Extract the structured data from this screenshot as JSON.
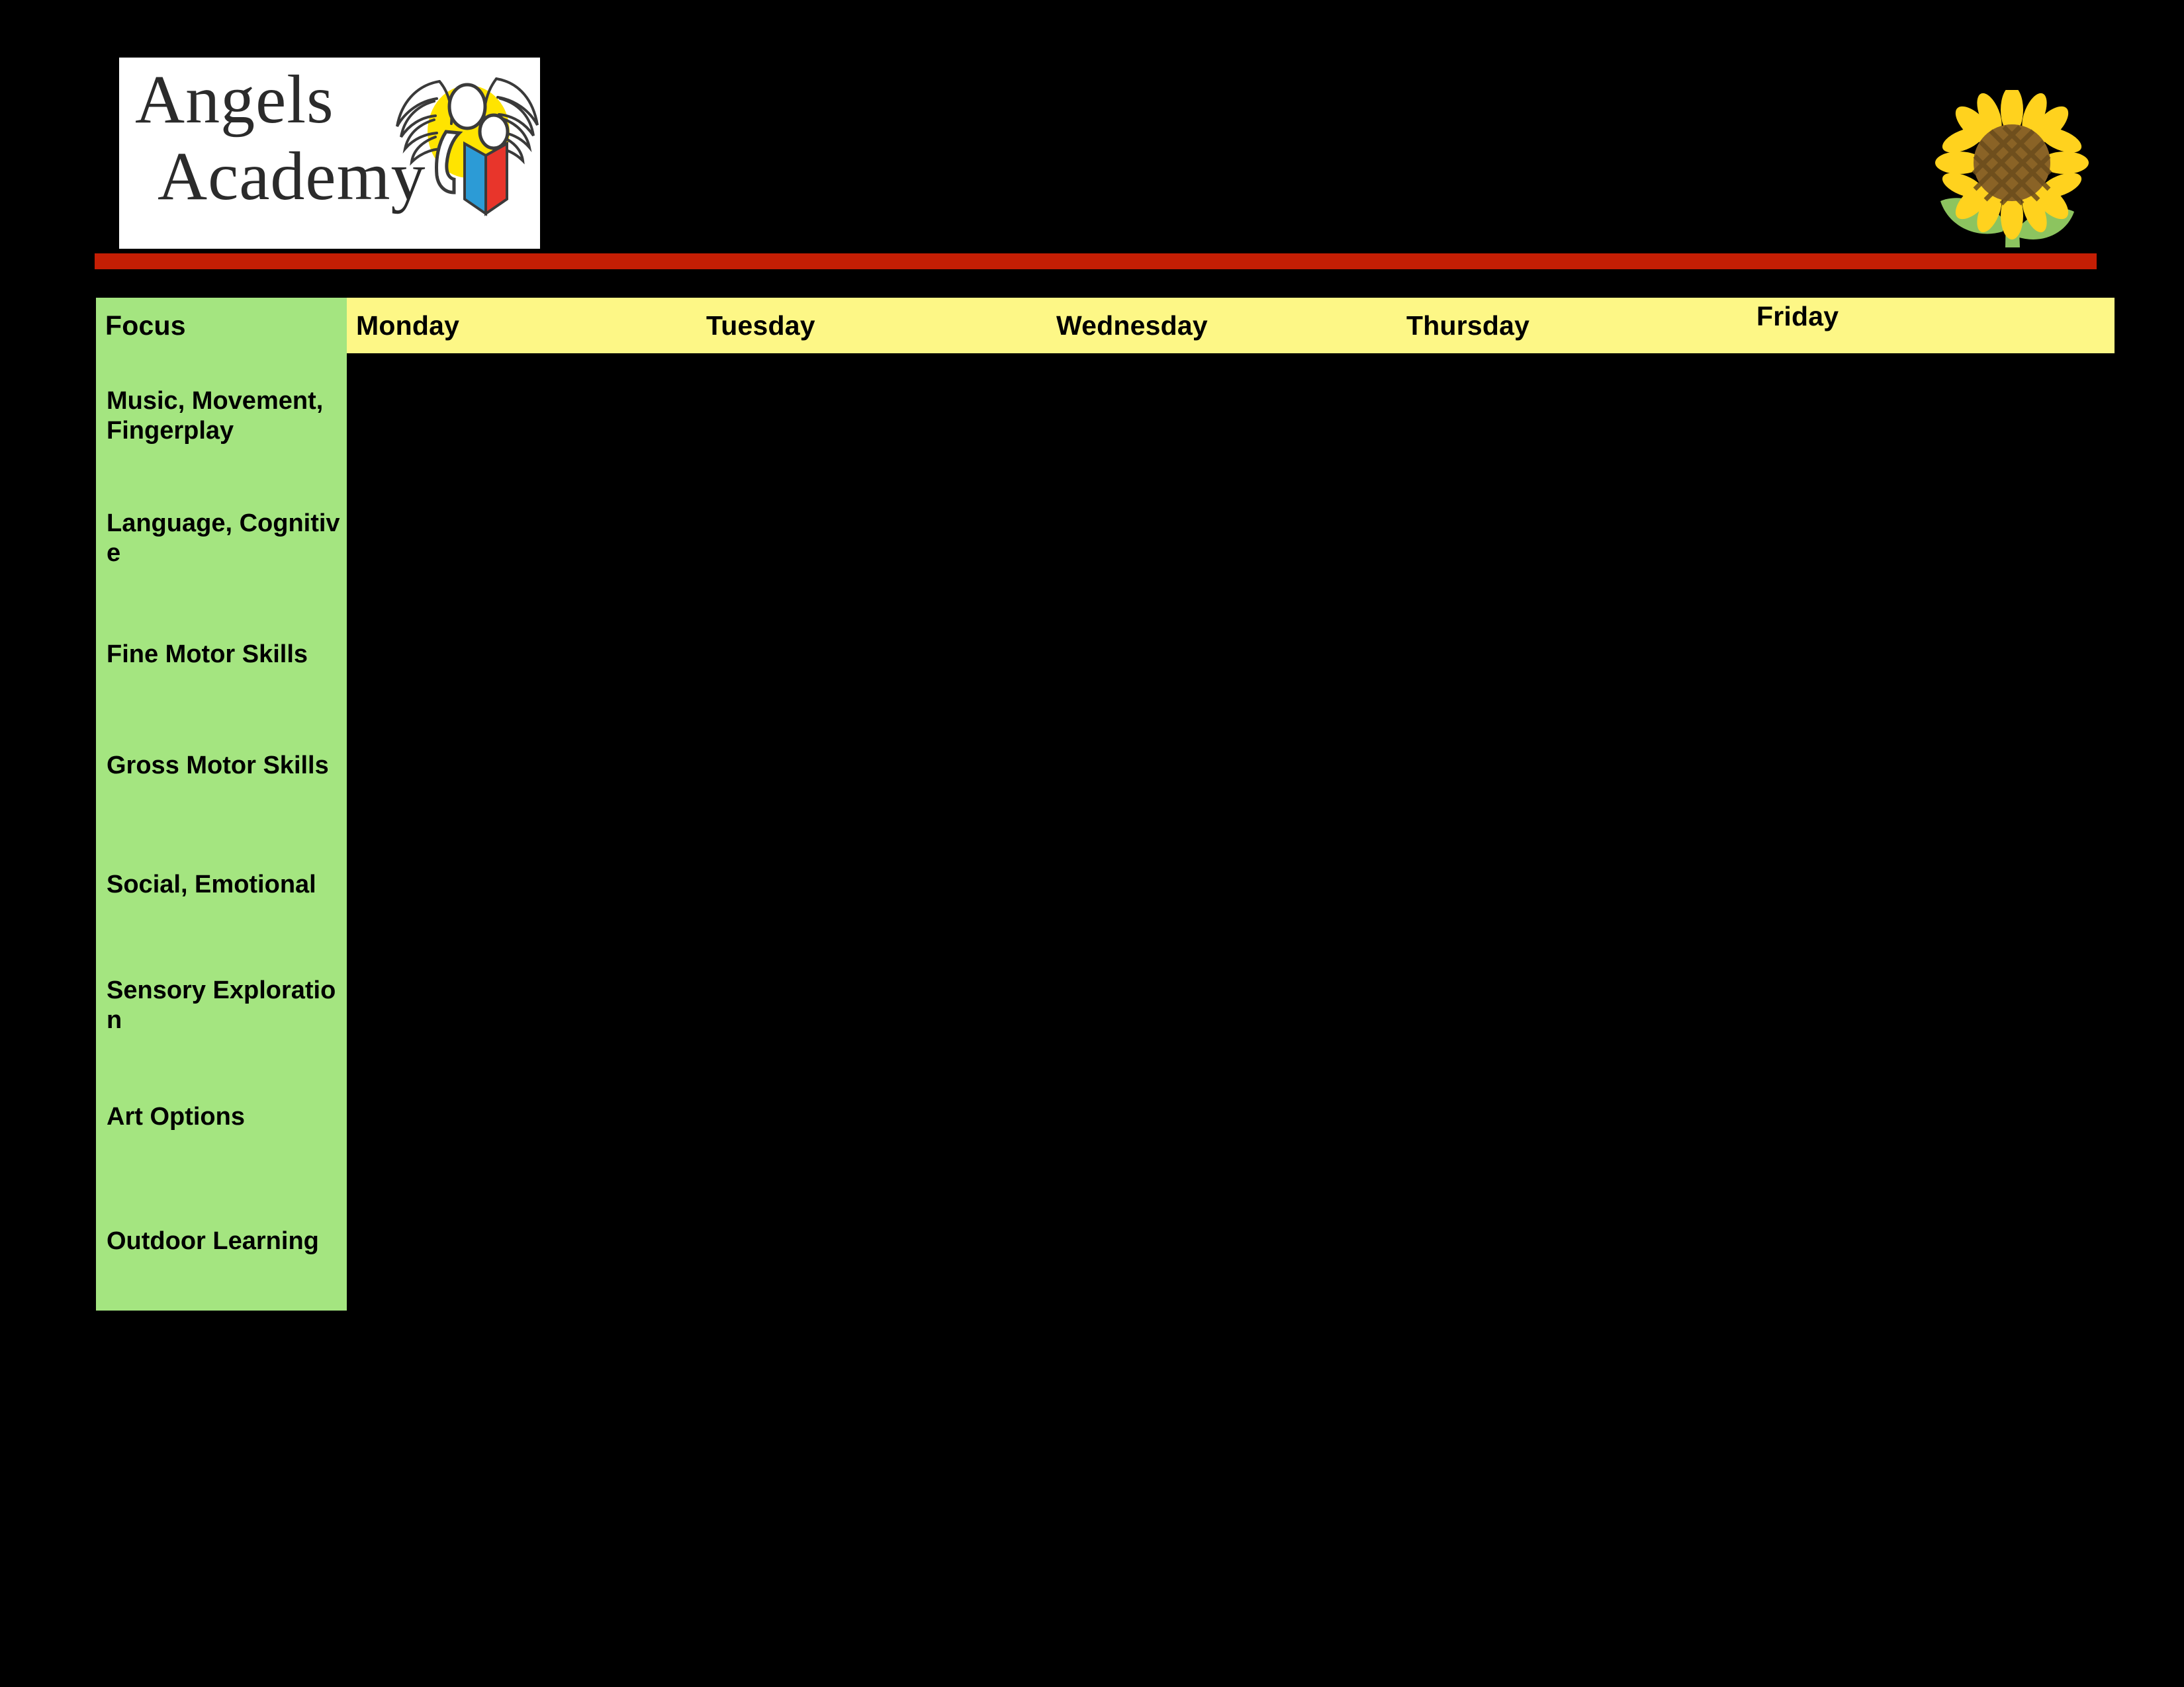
{
  "branding": {
    "logo": {
      "name_line_1": "Angels",
      "name_line_2": "Academy",
      "emblem_icon": "angel-reading-book-icon",
      "emblem_colors": {
        "halo": "#FFE400",
        "book_left": "#2C9BD6",
        "book_right": "#E8352B",
        "figure_outline": "#3A3A3A"
      }
    },
    "decoration": {
      "icon": "sunflower-icon",
      "petal_color": "#FFD21E",
      "center_color": "#8A6326",
      "leaf_color": "#8CC45F"
    },
    "divider_color": "#C41E04"
  },
  "planner": {
    "columns": [
      {
        "key": "focus",
        "label": "Focus",
        "header_bg": "#A4E580"
      },
      {
        "key": "monday",
        "label": "Monday",
        "header_bg": "#FDF786"
      },
      {
        "key": "tuesday",
        "label": "Tuesday",
        "header_bg": "#FDF786"
      },
      {
        "key": "wednesday",
        "label": "Wednesday",
        "header_bg": "#FDF786"
      },
      {
        "key": "thursday",
        "label": "Thursday",
        "header_bg": "#FDF786"
      },
      {
        "key": "friday",
        "label": "Friday",
        "header_bg": "#FDF786"
      }
    ],
    "rows": [
      {
        "focus": "Music, Movement, Fingerplay",
        "monday": "",
        "tuesday": "",
        "wednesday": "",
        "thursday": "",
        "friday": ""
      },
      {
        "focus": "Language, Cognitive",
        "monday": "",
        "tuesday": "",
        "wednesday": "",
        "thursday": "",
        "friday": ""
      },
      {
        "focus": "Fine Motor Skills",
        "monday": "",
        "tuesday": "",
        "wednesday": "",
        "thursday": "",
        "friday": ""
      },
      {
        "focus": "Gross Motor Skills",
        "monday": "",
        "tuesday": "",
        "wednesday": "",
        "thursday": "",
        "friday": ""
      },
      {
        "focus": "Social, Emotional",
        "monday": "",
        "tuesday": "",
        "wednesday": "",
        "thursday": "",
        "friday": ""
      },
      {
        "focus": "Sensory Exploration",
        "monday": "",
        "tuesday": "",
        "wednesday": "",
        "thursday": "",
        "friday": ""
      },
      {
        "focus": "Art Options",
        "monday": "",
        "tuesday": "",
        "wednesday": "",
        "thursday": "",
        "friday": ""
      },
      {
        "focus": "Outdoor Learning",
        "monday": "",
        "tuesday": "",
        "wednesday": "",
        "thursday": "",
        "friday": ""
      }
    ]
  }
}
